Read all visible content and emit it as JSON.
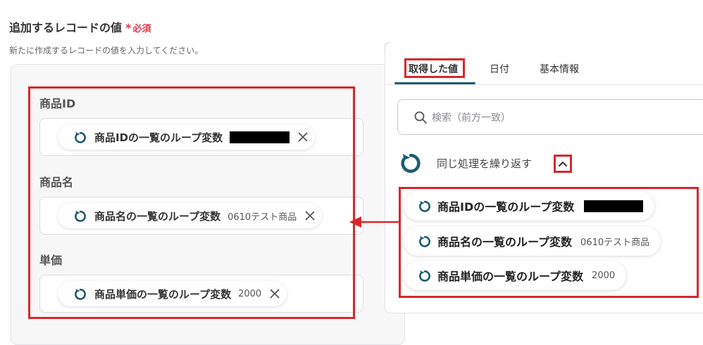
{
  "form": {
    "title": "追加するレコードの値",
    "required_mark": "*",
    "required_text": "必須",
    "description": "新たに作成するレコードの値を入力してください。",
    "fields": [
      {
        "label": "商品ID",
        "chip_label": "商品IDの一覧のループ変数",
        "chip_value": "",
        "redacted": true
      },
      {
        "label": "商品名",
        "chip_label": "商品名の一覧のループ変数",
        "chip_value": "0610テスト商品",
        "redacted": false
      },
      {
        "label": "単価",
        "chip_label": "商品単価の一覧のループ変数",
        "chip_value": "2000",
        "redacted": false
      }
    ]
  },
  "panel": {
    "tabs": [
      {
        "label": "取得した値",
        "active": true
      },
      {
        "label": "日付",
        "active": false
      },
      {
        "label": "基本情報",
        "active": false
      }
    ],
    "search_placeholder": "検索（前方一致）",
    "group_title": "同じ処理を繰り返す",
    "items": [
      {
        "label": "商品IDの一覧のループ変数",
        "value": "",
        "redacted": true
      },
      {
        "label": "商品名の一覧のループ変数",
        "value": "0610テスト商品",
        "redacted": false
      },
      {
        "label": "商品単価の一覧のループ変数",
        "value": "2000",
        "redacted": false
      }
    ]
  },
  "colors": {
    "accent": "#1e5d73",
    "highlight": "#d9262c",
    "required": "#e0394a"
  },
  "icons": [
    "loop-icon",
    "close-icon",
    "search-icon",
    "chevron-up-icon",
    "arrow-left-icon"
  ]
}
